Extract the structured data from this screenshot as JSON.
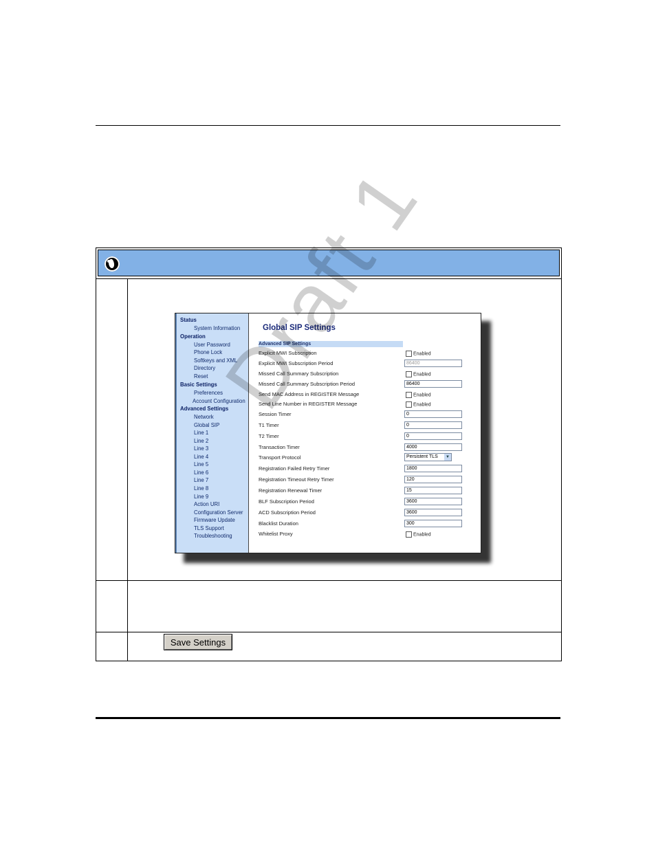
{
  "watermark": "Draft 1",
  "screenshot": {
    "sidebar": [
      {
        "label": "Status",
        "section": true
      },
      {
        "label": "System Information",
        "section": false
      },
      {
        "label": "Operation",
        "section": true
      },
      {
        "label": "User Password",
        "section": false
      },
      {
        "label": "Phone Lock",
        "section": false
      },
      {
        "label": "Softkeys and XML",
        "section": false
      },
      {
        "label": "Directory",
        "section": false
      },
      {
        "label": "Reset",
        "section": false
      },
      {
        "label": "Basic Settings",
        "section": true
      },
      {
        "label": "Preferences",
        "section": false
      },
      {
        "label": "Account Configuration",
        "section": false
      },
      {
        "label": "Advanced Settings",
        "section": true
      },
      {
        "label": "Network",
        "section": false
      },
      {
        "label": "Global SIP",
        "section": false
      },
      {
        "label": "Line 1",
        "section": false
      },
      {
        "label": "Line 2",
        "section": false
      },
      {
        "label": "Line 3",
        "section": false
      },
      {
        "label": "Line 4",
        "section": false
      },
      {
        "label": "Line 5",
        "section": false
      },
      {
        "label": "Line 6",
        "section": false
      },
      {
        "label": "Line 7",
        "section": false
      },
      {
        "label": "Line 8",
        "section": false
      },
      {
        "label": "Line 9",
        "section": false
      },
      {
        "label": "Action URI",
        "section": false
      },
      {
        "label": "Configuration Server",
        "section": false
      },
      {
        "label": "Firmware Update",
        "section": false
      },
      {
        "label": "TLS Support",
        "section": false
      },
      {
        "label": "Troubleshooting",
        "section": false
      }
    ],
    "title": "Global SIP Settings",
    "subheading": "Advanced SIP Settings",
    "rows": [
      {
        "label": "Explicit MWI Subscription",
        "type": "checkbox",
        "value": "Enabled"
      },
      {
        "label": "Explicit MWI Subscription Period",
        "type": "input",
        "value": "86400",
        "disabled": true
      },
      {
        "label": "Missed Call Summary Subscription",
        "type": "checkbox",
        "value": "Enabled"
      },
      {
        "label": "Missed Call Summary Subscription Period",
        "type": "input",
        "value": "86400"
      },
      {
        "label": "Send MAC Address in REGISTER Message",
        "type": "checkbox",
        "value": "Enabled"
      },
      {
        "label": "Send Line Number in REGISTER Message",
        "type": "checkbox",
        "value": "Enabled"
      },
      {
        "label": "Session Timer",
        "type": "input",
        "value": "0"
      },
      {
        "label": "T1 Timer",
        "type": "input",
        "value": "0"
      },
      {
        "label": "T2 Timer",
        "type": "input",
        "value": "0"
      },
      {
        "label": "Transaction Timer",
        "type": "input",
        "value": "4000"
      },
      {
        "label": "Transport Protocol",
        "type": "select",
        "value": "Persistent TLS"
      },
      {
        "label": "Registration Failed Retry Timer",
        "type": "input",
        "value": "1800"
      },
      {
        "label": "Registration Timeout Retry Timer",
        "type": "input",
        "value": "120"
      },
      {
        "label": "Registration Renewal Timer",
        "type": "input",
        "value": "15"
      },
      {
        "label": "BLF Subscription Period",
        "type": "input",
        "value": "3600"
      },
      {
        "label": "ACD Subscription Period",
        "type": "input",
        "value": "3600"
      },
      {
        "label": "Blacklist Duration",
        "type": "input",
        "value": "300"
      },
      {
        "label": "Whitelist Proxy",
        "type": "checkbox",
        "value": "Enabled"
      }
    ]
  },
  "save_button": "Save Settings"
}
